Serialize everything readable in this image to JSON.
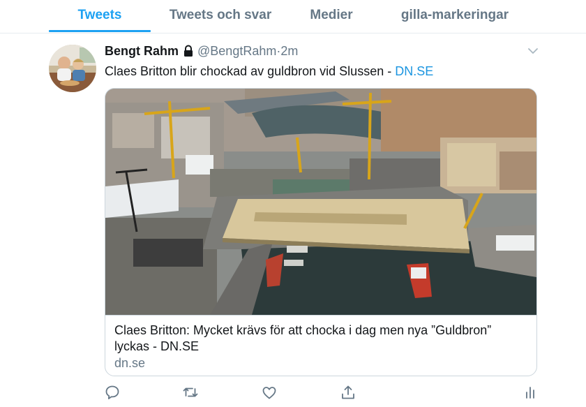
{
  "tabs": [
    {
      "label": "Tweets",
      "active": true
    },
    {
      "label": "Tweets och svar",
      "active": false
    },
    {
      "label": "Medier",
      "active": false
    },
    {
      "label": "gilla-markeringar",
      "active": false
    }
  ],
  "tweet": {
    "author_name": "Bengt Rahm",
    "protected_icon": "lock-icon",
    "handle": "@BengtRahm",
    "separator": "·",
    "time": "2m",
    "text": "Claes Britton blir chockad av guldbron vid Slussen - ",
    "text_link": "DN.SE",
    "card": {
      "title": "Claes Britton: Mycket krävs för att chocka i dag men nya ”Guldbron” lyckas - DN.SE",
      "domain": "dn.se"
    },
    "actions": [
      "reply-icon",
      "retweet-icon",
      "like-icon",
      "share-icon",
      "analytics-icon"
    ]
  },
  "colors": {
    "accent": "#1da1f2",
    "link": "#1b95e0",
    "secondary_text": "#657786",
    "border": "#ccd6dd",
    "bridge_gold": "#d8c79c",
    "water": "#2c3a3a"
  }
}
